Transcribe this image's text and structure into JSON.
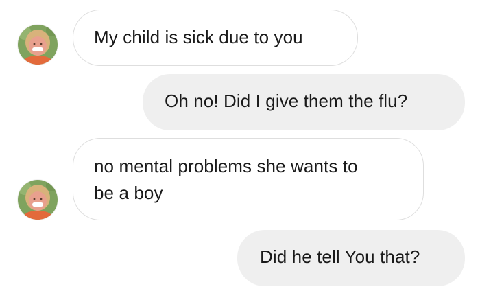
{
  "conversation": {
    "messages": [
      {
        "direction": "incoming",
        "text": "My child is sick due to you"
      },
      {
        "direction": "outgoing",
        "text": "Oh no! Did I give them the flu?"
      },
      {
        "direction": "incoming",
        "text": "no mental problems she wants to\nbe a boy"
      },
      {
        "direction": "outgoing",
        "text": "Did he tell You that?"
      }
    ]
  },
  "avatar": {
    "icon": "user-photo-avatar",
    "colors": {
      "background": "#7fa35e",
      "hair": "#d8b27b",
      "skin": "#e8a08e",
      "shirt": "#e36a3b"
    }
  },
  "theme": {
    "incoming_bubble_border": "#dedede",
    "outgoing_bubble_bg": "#efefef",
    "text_color": "#1a1a1a"
  }
}
